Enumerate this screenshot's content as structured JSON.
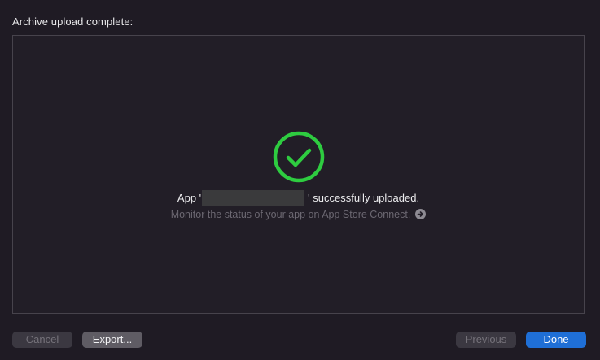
{
  "dialog": {
    "heading": "Archive upload complete:"
  },
  "status": {
    "icon": "checkmark-circle-icon",
    "icon_color": "#2ecc40",
    "message_prefix": "App '",
    "message_suffix": "' successfully uploaded.",
    "monitor_text": "Monitor the status of your app on App Store Connect.",
    "monitor_icon": "arrow-right-circle-icon"
  },
  "buttons": {
    "cancel": "Cancel",
    "export": "Export...",
    "previous": "Previous",
    "done": "Done"
  },
  "colors": {
    "accent": "#1f6fd6",
    "success": "#2ecc40"
  }
}
